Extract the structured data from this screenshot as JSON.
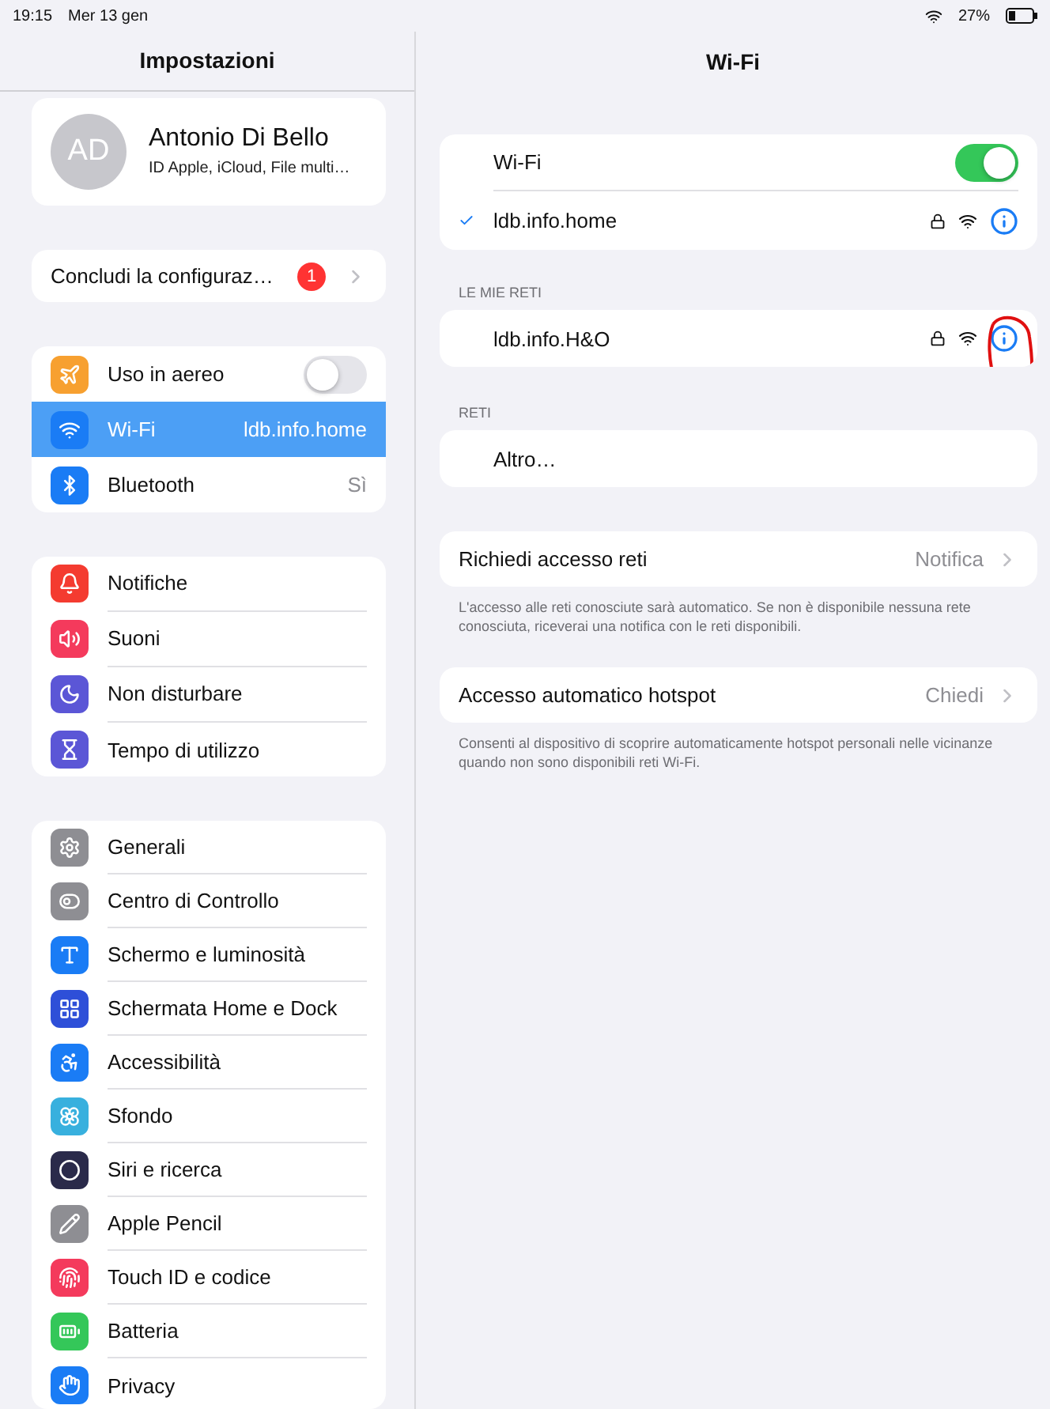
{
  "status_bar": {
    "time": "19:15",
    "date": "Mer 13 gen",
    "battery": "27%"
  },
  "sidebar": {
    "title": "Impostazioni",
    "profile": {
      "initials": "AD",
      "name": "Antonio Di Bello",
      "subtitle": "ID Apple, iCloud, File multi…"
    },
    "setup": {
      "label": "Concludi la configuraz…",
      "badge": "1"
    },
    "groups": [
      [
        {
          "label": "Uso in aereo",
          "kind": "toggle",
          "on": false,
          "selected": false,
          "color": "#f7a030"
        },
        {
          "label": "Wi-Fi",
          "kind": "value",
          "value": "ldb.info.home",
          "selected": true,
          "color": "#1a7cf5"
        },
        {
          "label": "Bluetooth",
          "kind": "value",
          "value": "Sì",
          "selected": false,
          "color": "#1a7cf5"
        }
      ],
      [
        {
          "label": "Notifiche",
          "kind": "plain",
          "selected": false,
          "color": "#f43b30"
        },
        {
          "label": "Suoni",
          "kind": "plain",
          "selected": false,
          "color": "#f43a5c"
        },
        {
          "label": "Non disturbare",
          "kind": "plain",
          "selected": false,
          "color": "#5b56d6"
        },
        {
          "label": "Tempo di utilizzo",
          "kind": "plain",
          "selected": false,
          "color": "#5b56d6"
        }
      ],
      [
        {
          "label": "Generali",
          "kind": "plain",
          "selected": false,
          "color": "#8e8e93"
        },
        {
          "label": "Centro di Controllo",
          "kind": "plain",
          "selected": false,
          "color": "#8e8e93"
        },
        {
          "label": "Schermo e luminosità",
          "kind": "plain",
          "selected": false,
          "color": "#1a7cf5"
        },
        {
          "label": "Schermata Home e Dock",
          "kind": "plain",
          "selected": false,
          "color": "#2e4fd8"
        },
        {
          "label": "Accessibilità",
          "kind": "plain",
          "selected": false,
          "color": "#1a7cf5"
        },
        {
          "label": "Sfondo",
          "kind": "plain",
          "selected": false,
          "color": "#38b0de"
        },
        {
          "label": "Siri e ricerca",
          "kind": "plain",
          "selected": false,
          "color": "#2a2a4a"
        },
        {
          "label": "Apple Pencil",
          "kind": "plain",
          "selected": false,
          "color": "#8e8e93"
        },
        {
          "label": "Touch ID e codice",
          "kind": "plain",
          "selected": false,
          "color": "#f43a5c"
        },
        {
          "label": "Batteria",
          "kind": "plain",
          "selected": false,
          "color": "#34c759"
        },
        {
          "label": "Privacy",
          "kind": "plain",
          "selected": false,
          "color": "#1a7cf5"
        }
      ]
    ]
  },
  "detail": {
    "title": "Wi-Fi",
    "wifi_toggle": {
      "label": "Wi-Fi",
      "on": true
    },
    "current_network": {
      "name": "ldb.info.home",
      "selected": true
    },
    "sections": [
      {
        "header": "LE MIE RETI",
        "networks": [
          {
            "name": "ldb.info.H&O",
            "kind": "network"
          }
        ]
      },
      {
        "header": "RETI",
        "networks": [
          {
            "name": "Altro…",
            "kind": "other"
          }
        ]
      }
    ],
    "options": [
      {
        "label": "Richiedi accesso reti",
        "value": "Notifica",
        "note": "L'accesso alle reti conosciute sarà automatico. Se non è disponibile nessuna rete conosciuta, riceverai una notifica con le reti disponibili."
      },
      {
        "label": "Accesso automatico hotspot",
        "value": "Chiedi",
        "note": "Consenti al dispositivo di scoprire automaticamente hotspot personali nelle vicinanze quando non sono disponibili reti Wi-Fi."
      }
    ]
  }
}
